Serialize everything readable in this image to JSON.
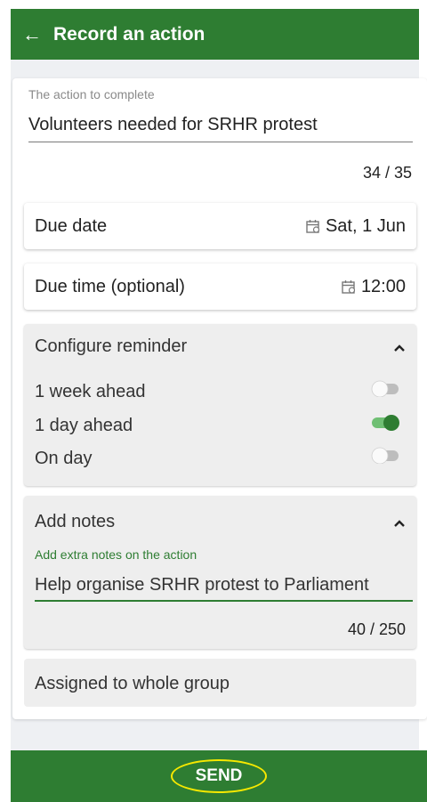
{
  "header": {
    "title": "Record an action",
    "back_icon": "arrow-left-icon"
  },
  "action_field": {
    "label": "The action to complete",
    "value": "Volunteers needed for SRHR protest",
    "counter": "34 / 35"
  },
  "due_date": {
    "label": "Due date",
    "value": "Sat, 1 Jun",
    "icon": "calendar-icon"
  },
  "due_time": {
    "label": "Due time (optional)",
    "value": "12:00",
    "icon": "calendar-icon"
  },
  "reminder": {
    "title": "Configure reminder",
    "options": [
      {
        "label": "1 week ahead",
        "enabled": false
      },
      {
        "label": "1 day ahead",
        "enabled": true
      },
      {
        "label": "On day",
        "enabled": false
      }
    ]
  },
  "notes": {
    "title": "Add notes",
    "label": "Add extra notes on the action",
    "value": "Help organise SRHR protest to Parliament",
    "counter": "40 / 250"
  },
  "assigned": {
    "label": "Assigned to whole group"
  },
  "footer": {
    "send_label": "SEND"
  },
  "colors": {
    "primary": "#2e7d32",
    "highlight": "#f5e800",
    "background": "#eef0f3"
  }
}
